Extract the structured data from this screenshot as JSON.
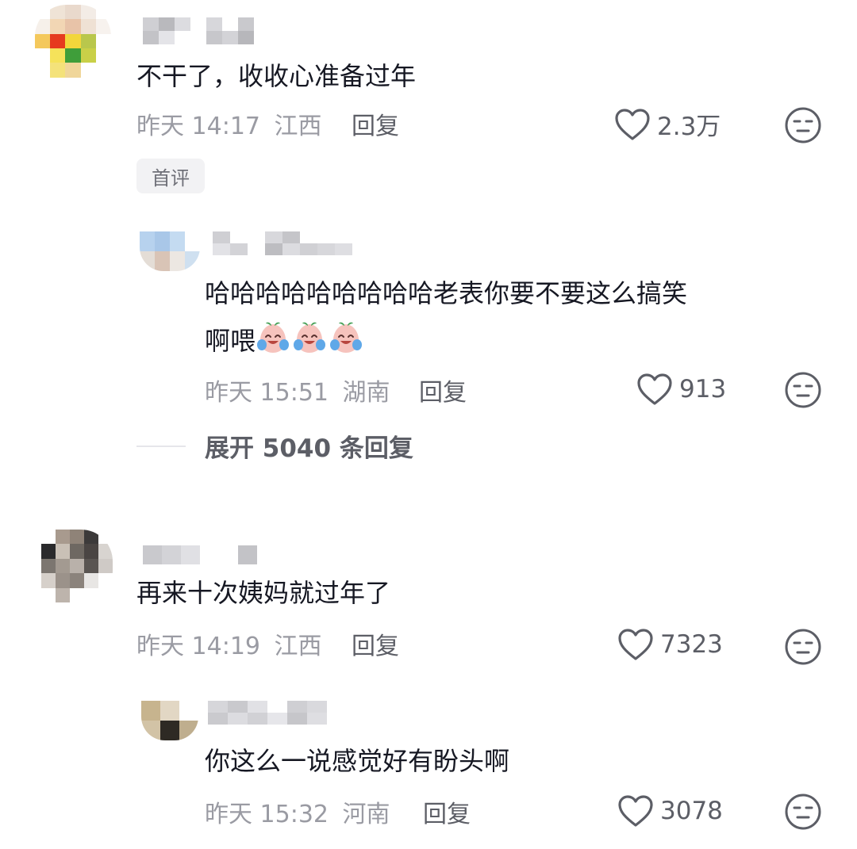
{
  "comments": [
    {
      "text": "不干了，收收心准备过年",
      "time": "昨天 14:17",
      "location": "江西",
      "reply_label": "回复",
      "likes": "2.3万",
      "badge": "首评",
      "replies": [
        {
          "text_line1": "哈哈哈哈哈哈哈哈哈老表你要不要这么搞笑",
          "text_line2": "啊喂",
          "time": "昨天 15:51",
          "location": "湖南",
          "reply_label": "回复",
          "likes": "913"
        }
      ],
      "expand_label": "展开 5040 条回复"
    },
    {
      "text": "再来十次姨妈就过年了",
      "time": "昨天 14:19",
      "location": "江西",
      "reply_label": "回复",
      "likes": "7323",
      "replies": [
        {
          "text_line1": "你这么一说感觉好有盼头啊",
          "time": "昨天 15:32",
          "location": "河南",
          "reply_label": "回复",
          "likes": "3078"
        }
      ]
    }
  ],
  "icons": {
    "like": "heart-outline-icon",
    "dislike": "unamused-face-icon",
    "emoji": "crying-laughing-peach-emoji"
  },
  "colors": {
    "text": "#161823",
    "meta": "#9a9ba3",
    "action": "#5c5e66"
  }
}
